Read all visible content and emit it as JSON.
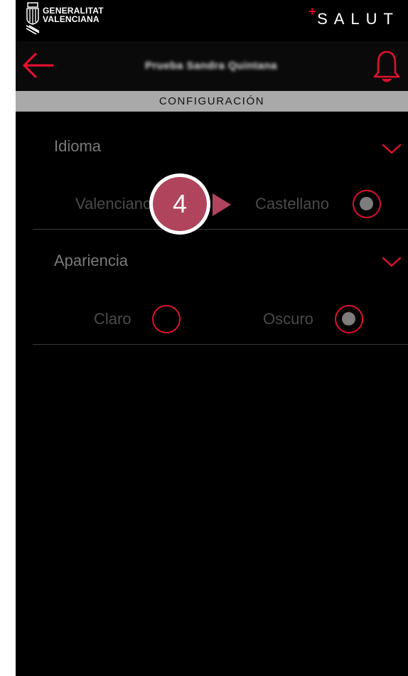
{
  "header": {
    "brand_line1": "GENERALITAT",
    "brand_line2": "VALENCIANA",
    "app_plus": "+",
    "app_name": "SALUT"
  },
  "nav": {
    "user_name": "Prueba Sandra Quintana",
    "back_icon": "arrow-left-icon",
    "bell_icon": "bell-icon"
  },
  "section": {
    "title": "CONFIGURACIÓN"
  },
  "settings": {
    "language": {
      "title": "Idioma",
      "options": [
        {
          "label": "Valenciano",
          "selected": false
        },
        {
          "label": "Castellano",
          "selected": true
        }
      ]
    },
    "appearance": {
      "title": "Apariencia",
      "options": [
        {
          "label": "Claro",
          "selected": false
        },
        {
          "label": "Oscuro",
          "selected": true
        }
      ]
    }
  },
  "callout": {
    "number": "4"
  },
  "colors": {
    "accent": "#e0102e",
    "callout": "#b0445d",
    "section_bar": "#a9a9a9",
    "background": "#000000"
  }
}
